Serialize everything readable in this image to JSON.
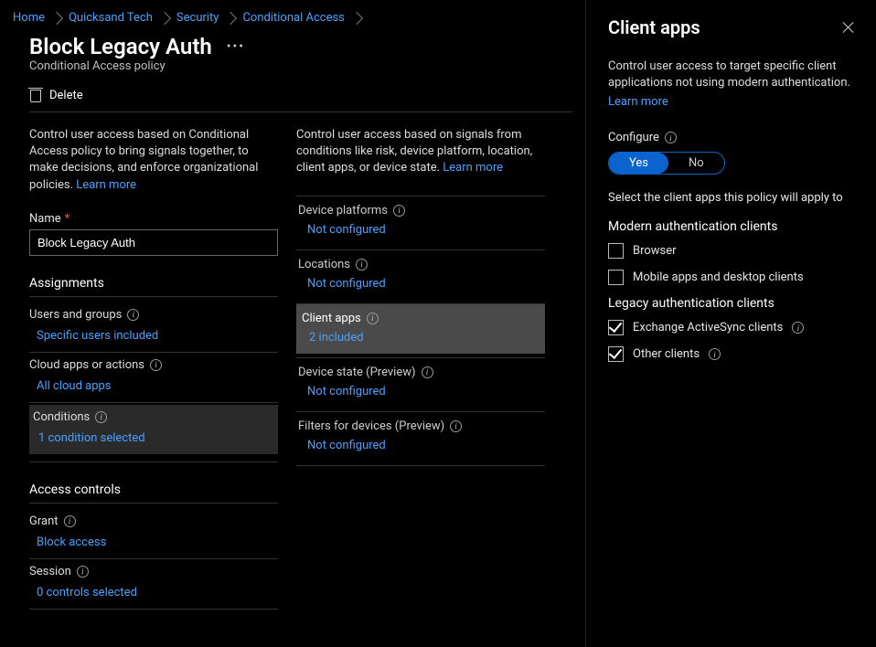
{
  "breadcrumb": {
    "home": "Home",
    "tenant": "Quicksand Tech",
    "security": "Security",
    "ca": "Conditional Access"
  },
  "header": {
    "title": "Block Legacy Auth",
    "subtitle": "Conditional Access policy",
    "delete": "Delete"
  },
  "left": {
    "desc_prefix": "Control user access based on Conditional Access policy to bring signals together, to make decisions, and enforce organizational policies. ",
    "learn_more": "Learn more",
    "name_label": "Name",
    "name_value": "Block Legacy Auth",
    "assignments_title": "Assignments",
    "users_label": "Users and groups",
    "users_value": "Specific users included",
    "cloud_label": "Cloud apps or actions",
    "cloud_value": "All cloud apps",
    "cond_label": "Conditions",
    "cond_value": "1 condition selected",
    "ac_title": "Access controls",
    "grant_label": "Grant",
    "grant_value": "Block access",
    "session_label": "Session",
    "session_value": "0 controls selected"
  },
  "middle": {
    "desc_prefix": "Control user access based on signals from conditions like risk, device platform, location, client apps, or device state. ",
    "learn_more": "Learn more",
    "dp_label": "Device platforms",
    "dp_val": "Not configured",
    "loc_label": "Locations",
    "loc_val": "Not configured",
    "ca_label": "Client apps",
    "ca_val": "2 included",
    "ds_label": "Device state (Preview)",
    "ds_val": "Not configured",
    "ff_label": "Filters for devices (Preview)",
    "ff_val": "Not configured"
  },
  "panel": {
    "title": "Client apps",
    "desc": "Control user access to target specific client applications not using modern authentication.",
    "learn_more": "Learn more",
    "configure": "Configure",
    "yes": "Yes",
    "no": "No",
    "select_text": "Select the client apps this policy will apply to",
    "modern_title": "Modern authentication clients",
    "browser": "Browser",
    "mobile": "Mobile apps and desktop clients",
    "legacy_title": "Legacy authentication clients",
    "eas": "Exchange ActiveSync clients",
    "other": "Other clients"
  }
}
